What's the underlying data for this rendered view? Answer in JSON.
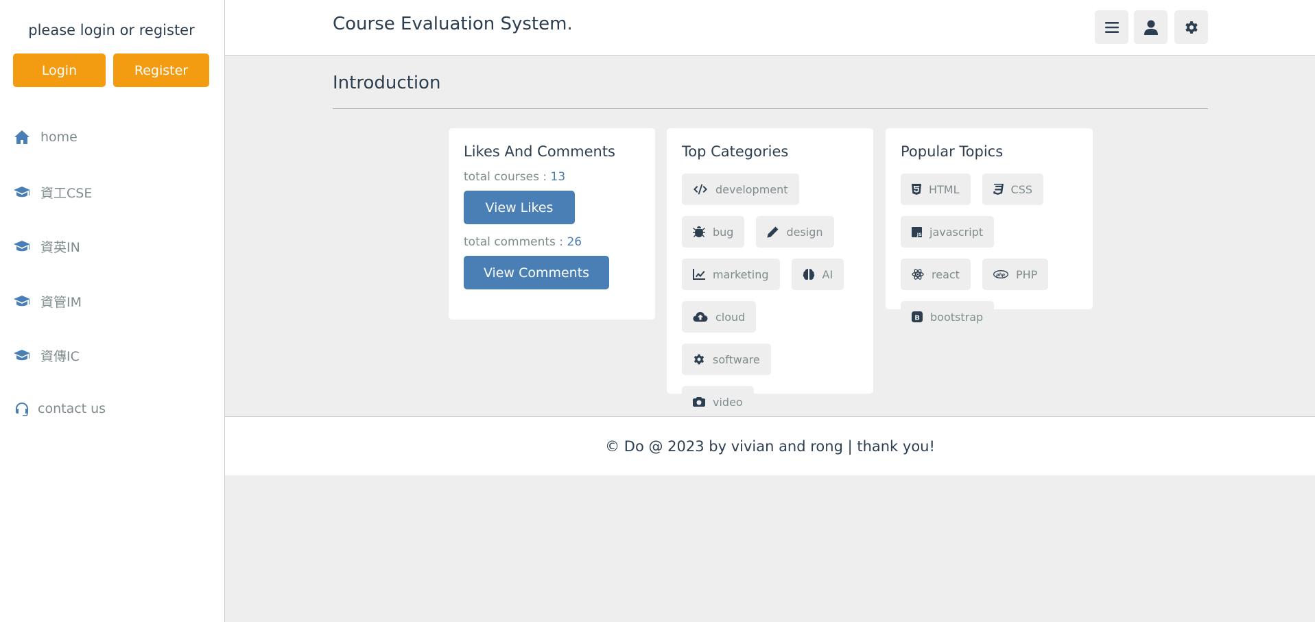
{
  "sidebar": {
    "profile_text": "please login or register",
    "login_label": "Login",
    "register_label": "Register",
    "items": [
      {
        "label": "home",
        "icon": "home-icon"
      },
      {
        "label": "資工CSE",
        "icon": "graduation-cap-icon"
      },
      {
        "label": "資英IN",
        "icon": "graduation-cap-icon"
      },
      {
        "label": "資管IM",
        "icon": "graduation-cap-icon"
      },
      {
        "label": "資傳IC",
        "icon": "graduation-cap-icon"
      },
      {
        "label": "contact us",
        "icon": "headset-icon"
      }
    ]
  },
  "header": {
    "logo": "Course Evaluation System.",
    "buttons": [
      "menu-icon",
      "user-icon",
      "gear-icon"
    ]
  },
  "main": {
    "heading": "Introduction",
    "likes": {
      "title": "Likes And Comments",
      "courses_label": "total courses : ",
      "courses_count": "13",
      "view_likes": "View Likes",
      "comments_label": "total comments : ",
      "comments_count": "26",
      "view_comments": "View Comments"
    },
    "categories": {
      "title": "Top Categories",
      "items": [
        {
          "label": "development",
          "icon": "code-icon"
        },
        {
          "label": "bug",
          "icon": "bug-icon"
        },
        {
          "label": "design",
          "icon": "pen-icon"
        },
        {
          "label": "marketing",
          "icon": "chart-line-icon"
        },
        {
          "label": "AI",
          "icon": "brain-icon"
        },
        {
          "label": "cloud",
          "icon": "cloud-upload-icon"
        },
        {
          "label": "software",
          "icon": "gear-icon"
        },
        {
          "label": "video",
          "icon": "camera-icon"
        }
      ]
    },
    "topics": {
      "title": "Popular Topics",
      "items": [
        {
          "label": "HTML",
          "icon": "html5-icon"
        },
        {
          "label": "CSS",
          "icon": "css3-icon"
        },
        {
          "label": "javascript",
          "icon": "js-icon"
        },
        {
          "label": "react",
          "icon": "react-icon"
        },
        {
          "label": "PHP",
          "icon": "php-icon"
        },
        {
          "label": "bootstrap",
          "icon": "bootstrap-icon"
        }
      ]
    }
  },
  "footer": {
    "text": "© Do @ 2023 by vivian and rong | thank you!"
  },
  "colors": {
    "accent_orange": "#f39c12",
    "accent_blue": "#4a7fb5",
    "text_dark": "#2c3e50",
    "text_muted": "#7f8c8d",
    "background": "#eeeeee"
  }
}
